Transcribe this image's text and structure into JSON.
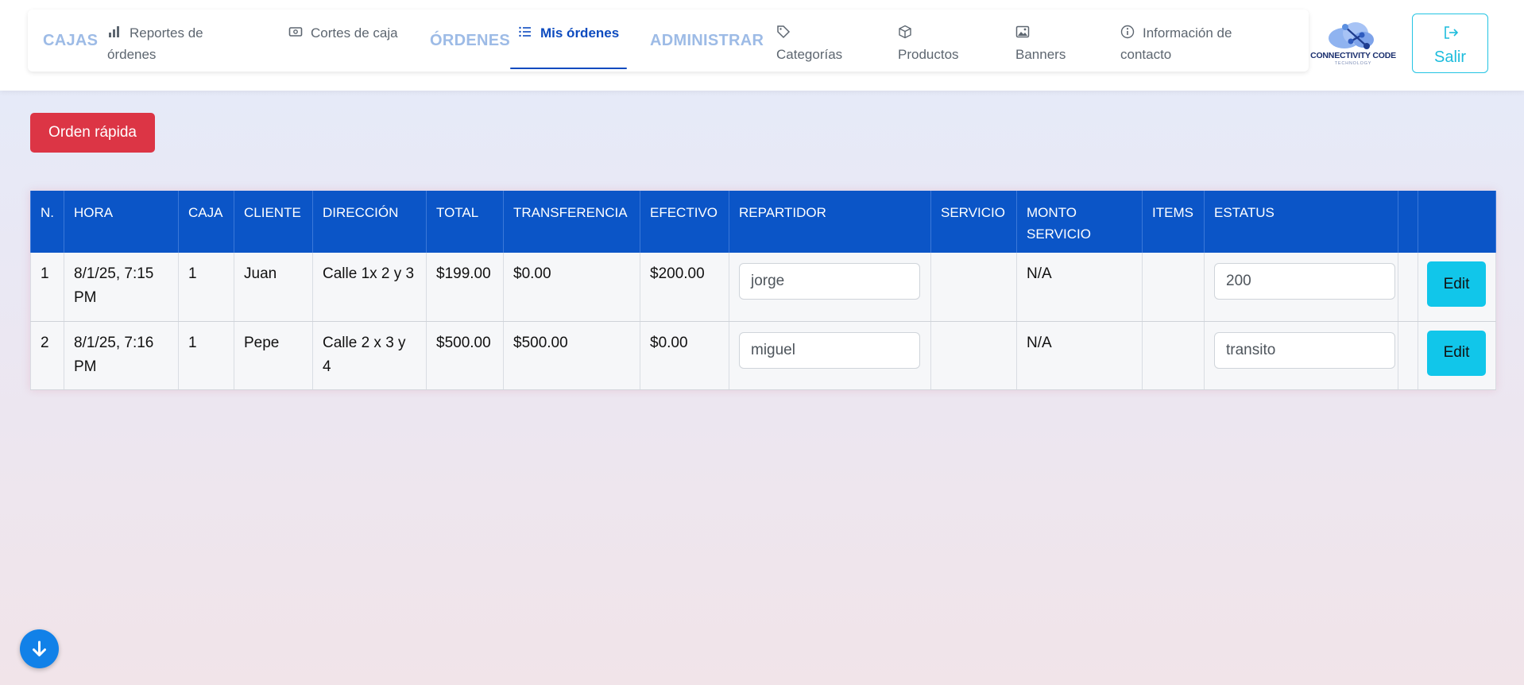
{
  "nav": {
    "cajas_label": "CAJAS",
    "reportes_label": "Reportes de órdenes",
    "cortes_label": "Cortes de caja",
    "ordenes_label": "ÓRDENES",
    "mis_ordenes_label": "Mis órdenes",
    "administrar_label": "ADMINISTRAR",
    "categorias_label": "Categorías",
    "productos_label": "Productos",
    "banners_label": "Banners",
    "info_label": "Información de contacto",
    "logout_label": "Salir",
    "logo_text": "CONNECTIVITY CODE",
    "logo_subtext": "TECHNOLOGY",
    "accent_color": "#0d4bbf"
  },
  "actions": {
    "quick_order_label": "Orden rápida"
  },
  "table": {
    "headers": [
      "N.",
      "HORA",
      "CAJA",
      "CLIENTE",
      "DIRECCIÓN",
      "TOTAL",
      "TRANSFERENCIA",
      "EFECTIVO",
      "REPARTIDOR",
      "SERVICIO",
      "MONTO SERVICIO",
      "ITEMS",
      "ESTATUS",
      "",
      ""
    ],
    "rows": [
      {
        "n": "1",
        "hora": "8/1/25, 7:15 PM",
        "caja": "1",
        "cliente": "Juan",
        "direccion": "Calle 1x 2 y 3",
        "total": "$199.00",
        "transferencia": "$0.00",
        "efectivo": "$200.00",
        "repartidor": "jorge",
        "servicio": "",
        "monto_servicio": "N/A",
        "items": "",
        "estatus": "200",
        "edit_label": "Edit"
      },
      {
        "n": "2",
        "hora": "8/1/25, 7:16 PM",
        "caja": "1",
        "cliente": "Pepe",
        "direccion": "Calle 2 x 3 y 4",
        "total": "$500.00",
        "transferencia": "$500.00",
        "efectivo": "$0.00",
        "repartidor": "miguel",
        "servicio": "",
        "monto_servicio": "N/A",
        "items": "",
        "estatus": "transito",
        "edit_label": "Edit"
      }
    ]
  },
  "fab": {
    "icon": "arrow-down-icon"
  },
  "colors": {
    "header_bg": "#0b55c7",
    "danger": "#dc3545",
    "info": "#11c6ea",
    "fab": "#1181e8"
  }
}
